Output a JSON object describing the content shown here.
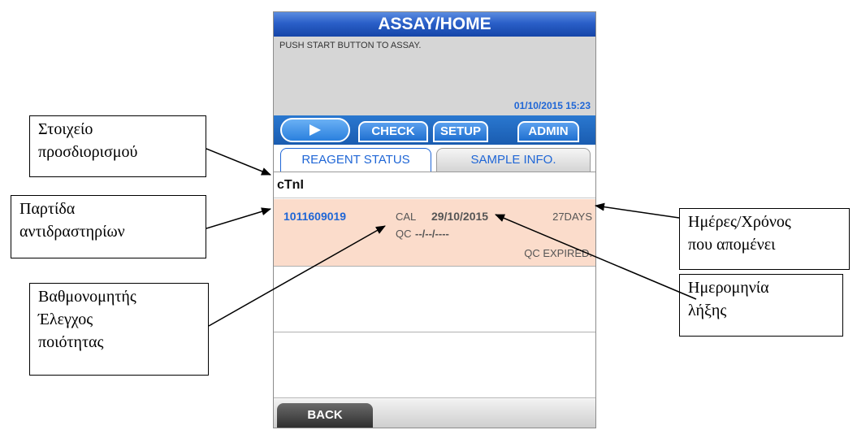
{
  "screen": {
    "title": "ASSAY/HOME",
    "message": "PUSH START BUTTON TO ASSAY.",
    "datetime": "01/10/2015 15:23",
    "menu": {
      "check": "CHECK",
      "setup": "SETUP",
      "admin": "ADMIN"
    },
    "tabs": {
      "reagent_status": "REAGENT STATUS",
      "sample_info": "SAMPLE INFO."
    },
    "assay_name": "cTnI",
    "reagent": {
      "lot": "1011609019",
      "cal_label": "CAL",
      "cal_date": "29/10/2015",
      "days_left": "27DAYS",
      "qc_label": "QC",
      "qc_date": "--/--/----",
      "qc_status": "QC EXPIRED."
    },
    "back": "BACK"
  },
  "callouts": {
    "assay_item": [
      "Στοιχείο",
      "προσδιορισμού"
    ],
    "reagent_lot": [
      "Παρτίδα",
      "αντιδραστηρίων"
    ],
    "cal_qc": [
      "Βαθμονομητής",
      "Έλεγχος",
      "ποιότητας"
    ],
    "days_remaining": [
      "Ημέρες/Χρόνος",
      "που απομένει"
    ],
    "expiry_date": [
      "Ημερομηνία",
      "λήξης"
    ]
  },
  "colors": {
    "title_bar": "#2a5fc8",
    "menu_bar": "#1a5cb0",
    "accent_text": "#1f66d6",
    "reagent_row": "#fbdccb"
  }
}
